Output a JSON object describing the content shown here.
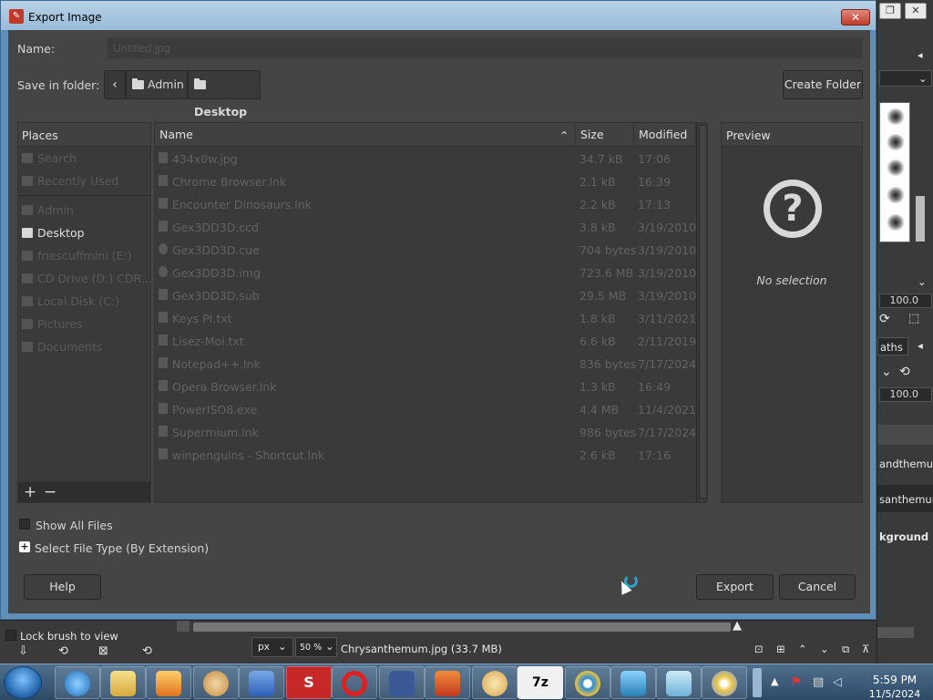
{
  "dialog": {
    "title": "Export Image",
    "close_label": "✕",
    "name_label": "Name:",
    "name_value": "Untitled.jpg",
    "save_in_label": "Save in folder:",
    "breadcrumbs": [
      "Admin",
      "Desktop"
    ],
    "create_folder_label": "Create Folder"
  },
  "places": {
    "header": "Places",
    "items": [
      {
        "label": "Search",
        "icon": "search-icon"
      },
      {
        "label": "Recently Used",
        "icon": "clock-icon"
      },
      {
        "label": "Admin",
        "icon": "folder-icon"
      },
      {
        "label": "Desktop",
        "icon": "folder-icon"
      },
      {
        "label": "friescuffmini (E:)",
        "icon": "drive-icon"
      },
      {
        "label": "CD Drive (D:) CDR...",
        "icon": "cd-icon"
      },
      {
        "label": "Local Disk (C:)",
        "icon": "drive-icon"
      },
      {
        "label": "Pictures",
        "icon": "folder-icon"
      },
      {
        "label": "Documents",
        "icon": "folder-icon"
      }
    ],
    "add_label": "+",
    "remove_label": "−"
  },
  "files": {
    "columns": {
      "name": "Name",
      "size": "Size",
      "modified": "Modified"
    },
    "sort_indicator": "⌃",
    "rows": [
      {
        "name": "434x0w.jpg",
        "size": "34.7 kB",
        "modified": "17:06"
      },
      {
        "name": "Chrome Browser.lnk",
        "size": "2.1 kB",
        "modified": "16:39"
      },
      {
        "name": "Encounter Dinosaurs.lnk",
        "size": "2.2 kB",
        "modified": "17:13"
      },
      {
        "name": "Gex3DD3D.ccd",
        "size": "3.8 kB",
        "modified": "3/19/2010"
      },
      {
        "name": "Gex3DD3D.cue",
        "size": "704 bytes",
        "modified": "3/19/2010"
      },
      {
        "name": "Gex3DD3D.img",
        "size": "723.6 MB",
        "modified": "3/19/2010"
      },
      {
        "name": "Gex3DD3D.sub",
        "size": "29.5 MB",
        "modified": "3/19/2010"
      },
      {
        "name": "Keys PI.txt",
        "size": "1.8 kB",
        "modified": "3/11/2021"
      },
      {
        "name": "Lisez-Moi.txt",
        "size": "6.6 kB",
        "modified": "2/11/2019"
      },
      {
        "name": "Notepad++.lnk",
        "size": "836 bytes",
        "modified": "7/17/2024"
      },
      {
        "name": "Opera Browser.lnk",
        "size": "1.3 kB",
        "modified": "16:49"
      },
      {
        "name": "PowerISO8.exe",
        "size": "4.4 MB",
        "modified": "11/4/2021"
      },
      {
        "name": "Supermium.lnk",
        "size": "986 bytes",
        "modified": "7/17/2024"
      },
      {
        "name": "winpenguins - Shortcut.lnk",
        "size": "2.6 kB",
        "modified": "17:16"
      }
    ]
  },
  "preview": {
    "header": "Preview",
    "empty_text": "No selection",
    "icon": "question-icon"
  },
  "options": {
    "show_all_files": "Show All Files",
    "select_file_type": "Select File Type (By Extension)"
  },
  "buttons": {
    "help": "Help",
    "export": "Export",
    "cancel": "Cancel"
  },
  "gimp": {
    "opacity_value": "100.0",
    "spacing_value": "100.0",
    "paths_tab": "aths",
    "layer1": "andthemum",
    "layer2": "santhemum",
    "layer3": "kground",
    "lock_brush": "Lock brush to view",
    "unit": "px",
    "zoom": "50 %",
    "status_file": "Chrysanthemum.jpg (33.7 MB)"
  },
  "taskbar": {
    "time": "5:59 PM",
    "date": "11/5/2024",
    "s_label": "S",
    "sevenzip_label": "7z"
  }
}
